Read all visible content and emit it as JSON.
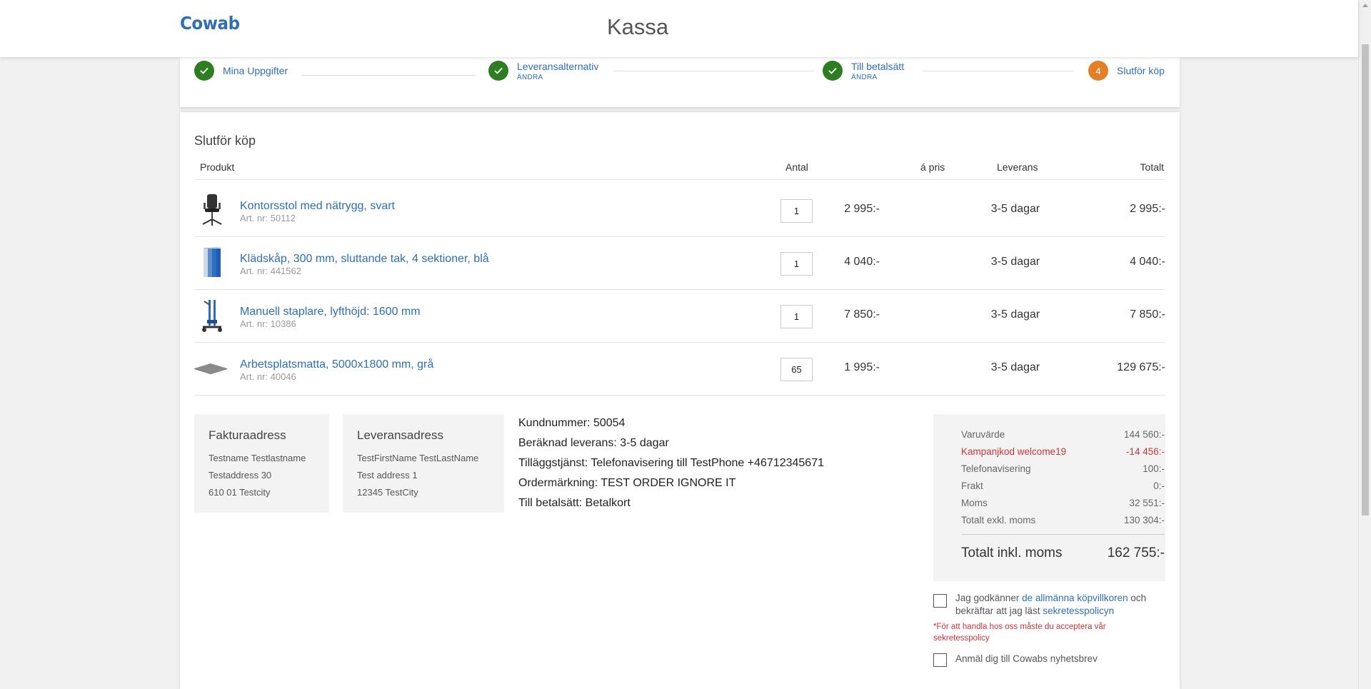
{
  "header": {
    "logo": "Cowab",
    "title": "Kassa"
  },
  "stepper": {
    "steps": [
      {
        "label": "Mina Uppgifter",
        "edit": "",
        "icon": "check-icon"
      },
      {
        "label": "Leveransalternativ",
        "edit": "ÄNDRA",
        "icon": "check-icon"
      },
      {
        "label": "Till betalsätt",
        "edit": "ÄNDRA",
        "icon": "check-icon"
      },
      {
        "label": "Slutför köp",
        "edit": "",
        "number": "4"
      }
    ]
  },
  "main": {
    "section_title": "Slutför köp",
    "columns": {
      "product": "Produkt",
      "qty": "Antal",
      "unit_price": "á pris",
      "delivery": "Leverans",
      "total": "Totalt"
    },
    "products": [
      {
        "name": "Kontorsstol med nätrygg, svart",
        "art": "Art. nr: 50112",
        "qty": "1",
        "unit_price": "2 995:-",
        "delivery": "3-5 dagar",
        "total": "2 995:-",
        "image": "office-chair-image"
      },
      {
        "name": "Klädskåp, 300 mm, sluttande tak, 4 sektioner, blå",
        "art": "Art. nr: 441562",
        "qty": "1",
        "unit_price": "4 040:-",
        "delivery": "3-5 dagar",
        "total": "4 040:-",
        "image": "wardrobe-image"
      },
      {
        "name": "Manuell staplare, lyfthöjd: 1600 mm",
        "art": "Art. nr: 10386",
        "qty": "1",
        "unit_price": "7 850:-",
        "delivery": "3-5 dagar",
        "total": "7 850:-",
        "image": "stacker-image"
      },
      {
        "name": "Arbetsplatsmatta, 5000x1800 mm, grå",
        "art": "Art. nr: 40046",
        "qty": "65",
        "unit_price": "1 995:-",
        "delivery": "3-5 dagar",
        "total": "129 675:-",
        "image": "floor-mat-image"
      }
    ]
  },
  "billing": {
    "title": "Fakturaadress",
    "lines": [
      "Testname Testlastname",
      "Testaddress 30",
      "610 01 Testcity"
    ]
  },
  "shipping": {
    "title": "Leveransadress",
    "lines": [
      "TestFirstName TestLastName",
      "Test address 1",
      "12345 TestCity"
    ]
  },
  "order_info": {
    "lines": [
      "Kundnummer: 50054",
      "Beräknad leverans: 3-5 dagar",
      "Tilläggstjänst: Telefonavisering till TestPhone +46712345671",
      "Ordermärkning: TEST ORDER IGNORE IT",
      "Till betalsätt: Betalkort"
    ]
  },
  "summary": {
    "rows": [
      {
        "label": "Varuvärde",
        "value": "144 560:-"
      },
      {
        "label": "Kampanjkod welcome19",
        "value": "-14 456:-"
      },
      {
        "label": "Telefonavisering",
        "value": "100:-"
      },
      {
        "label": "Frakt",
        "value": "0:-"
      },
      {
        "label": "Moms",
        "value": "32 551:-"
      },
      {
        "label": "Totalt exkl. moms",
        "value": "130 304:-"
      }
    ],
    "total_label": "Totalt inkl. moms",
    "total_value": "162 755:-"
  },
  "terms": {
    "text_before": "Jag godkänner ",
    "link_terms": "de allmänna köpvillkoren",
    "text_middle": " och bekräftar att jag läst ",
    "link_privacy": "sekretesspolicyn",
    "warning": "*För att handla hos oss måste du acceptera vår sekretesspolicy"
  },
  "newsletter": {
    "label": "Anmäl dig till Cowabs nyhetsbrev"
  },
  "colors": {
    "brand": "#2f6fb3",
    "step_done": "#2e7d22",
    "step_current": "#e2802a",
    "discount": "#c8343a"
  }
}
